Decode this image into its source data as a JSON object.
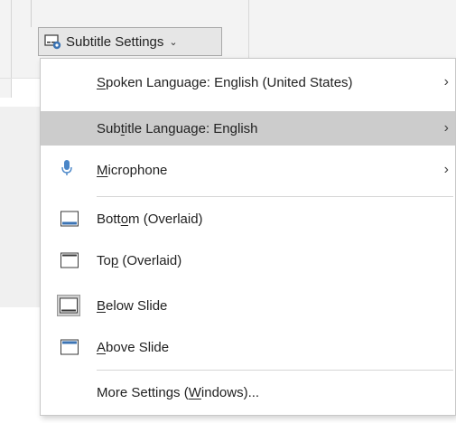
{
  "button": {
    "label": "Subtitle Settings",
    "chevron": "⌄",
    "icon": "subtitle-settings-icon"
  },
  "menu": {
    "items": [
      {
        "pre": "",
        "ul": "S",
        "post": "poken Language: English (United States)",
        "arrow": "›"
      },
      {
        "pre": "Sub",
        "ul": "t",
        "post": "itle Language: English",
        "arrow": "›",
        "highlighted": true
      },
      {
        "pre": "",
        "ul": "M",
        "post": "icrophone",
        "arrow": "›",
        "icon": "microphone-icon"
      },
      {
        "pre": "Bott",
        "ul": "o",
        "post": "m (Overlaid)",
        "icon": "position-bottom-icon"
      },
      {
        "pre": "To",
        "ul": "p",
        "post": " (Overlaid)",
        "icon": "position-top-icon"
      },
      {
        "pre": "",
        "ul": "B",
        "post": "elow Slide",
        "icon": "position-below-icon",
        "selected": true
      },
      {
        "pre": "",
        "ul": "A",
        "post": "bove Slide",
        "icon": "position-above-icon"
      },
      {
        "pre": "More Settings (",
        "ul": "W",
        "post": "indows)..."
      }
    ]
  },
  "colors": {
    "highlight": "#cccccc",
    "accent": "#3c74b4",
    "mic": "#4a86c8"
  }
}
